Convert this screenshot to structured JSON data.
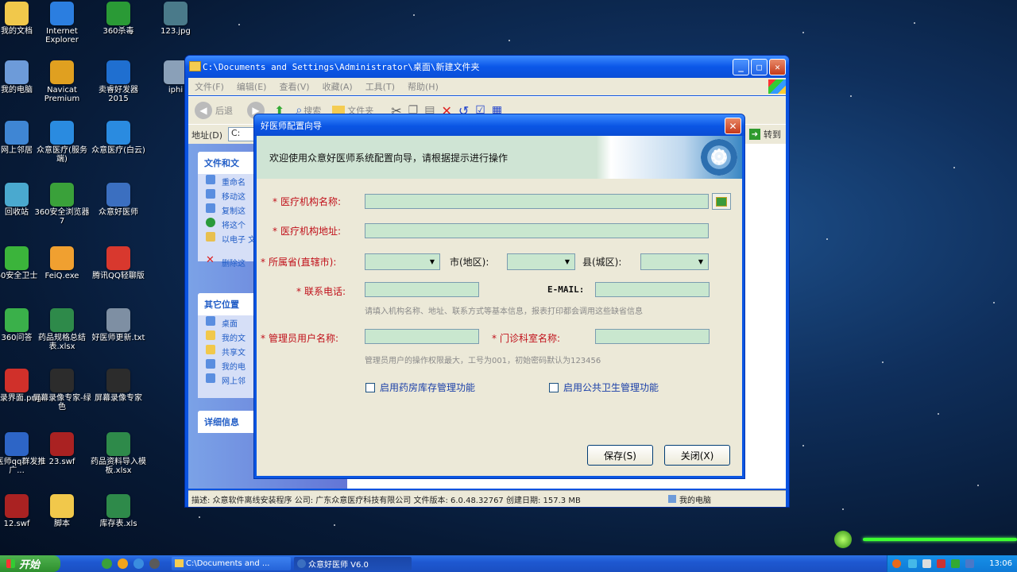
{
  "desktop": {
    "icons": [
      {
        "label": "我的文档",
        "icon": "folder-icon",
        "color": "#f1c84b"
      },
      {
        "label": "Internet Explorer",
        "icon": "ie-icon",
        "color": "#2b7ee0"
      },
      {
        "label": "360杀毒",
        "icon": "shield-icon",
        "color": "#2a9a36"
      },
      {
        "label": "123.jpg",
        "icon": "image-icon",
        "color": "#4a7a8a"
      },
      {
        "label": "我的电脑",
        "icon": "computer-icon",
        "color": "#6d9bd9"
      },
      {
        "label": "Navicat Premium",
        "icon": "navicat-icon",
        "color": "#e0a020"
      },
      {
        "label": "卖睿好发器 2015",
        "icon": "h-icon",
        "color": "#1f6fd0"
      },
      {
        "label": "iphi",
        "icon": "file-icon",
        "color": "#8aa0b8"
      },
      {
        "label": "网上邻居",
        "icon": "network-icon",
        "color": "#3f86d4"
      },
      {
        "label": "众意医疗(服务端)",
        "icon": "medical-icon",
        "color": "#2a8be0"
      },
      {
        "label": "众意医疗(白云)",
        "icon": "medical-icon",
        "color": "#2a8be0"
      },
      {
        "label": "回收站",
        "icon": "recycle-bin-icon",
        "color": "#4aa9cf"
      },
      {
        "label": "360安全浏览器7",
        "icon": "browser-icon",
        "color": "#3aa13a"
      },
      {
        "label": "众意好医师",
        "icon": "penguin-icon",
        "color": "#3b6fc0"
      },
      {
        "label": "60安全卫士",
        "icon": "guard-icon",
        "color": "#3bb43b"
      },
      {
        "label": "FeiQ.exe",
        "icon": "feiq-icon",
        "color": "#f0a030"
      },
      {
        "label": "腾讯QQ轻聊版",
        "icon": "qq-icon",
        "color": "#d8382e"
      },
      {
        "label": "360问答",
        "icon": "qa-icon",
        "color": "#3ab04a"
      },
      {
        "label": "药品规格总结表.xlsx",
        "icon": "excel-icon",
        "color": "#2e8a4a"
      },
      {
        "label": "好医师更新.txt",
        "icon": "text-icon",
        "color": "#7e8fa3"
      },
      {
        "label": "登录界面.png",
        "icon": "png-icon",
        "color": "#d0302a"
      },
      {
        "label": "屏幕录像专家-绿色",
        "icon": "recorder-icon",
        "color": "#2c2c2c"
      },
      {
        "label": "屏幕录像专家",
        "icon": "recorder-icon",
        "color": "#2c2c2c"
      },
      {
        "label": "好医师qq群发推广...",
        "icon": "doc-icon",
        "color": "#2d65c6"
      },
      {
        "label": "23.swf",
        "icon": "swf-icon",
        "color": "#aa2222"
      },
      {
        "label": "药品资料导入模板.xlsx",
        "icon": "excel-icon",
        "color": "#2e8a4a"
      },
      {
        "label": "12.swf",
        "icon": "swf-icon",
        "color": "#aa2222"
      },
      {
        "label": "脚本",
        "icon": "folder-icon",
        "color": "#f1c84b"
      },
      {
        "label": "库存表.xls",
        "icon": "excel-icon",
        "color": "#2e8a4a"
      }
    ]
  },
  "explorer": {
    "title": "C:\\Documents and Settings\\Administrator\\桌面\\新建文件夹",
    "menu": [
      "文件(F)",
      "编辑(E)",
      "查看(V)",
      "收藏(A)",
      "工具(T)",
      "帮助(H)"
    ],
    "toolbar": {
      "back": "后退",
      "search": "搜索",
      "folders": "文件夹"
    },
    "address_label": "地址(D)",
    "address_value": "C:",
    "go": "转到",
    "tasks_header": "文件和文",
    "tasks": [
      "重命名",
      "移动这",
      "复制这",
      "将这个",
      "以电子 文件",
      "删除这"
    ],
    "other_header": "其它位置",
    "other": [
      "桌面",
      "我的文",
      "共享文",
      "我的电",
      "网上邻"
    ],
    "details_header": "详细信息",
    "status": "描述: 众意软件离线安装程序  公司: 广东众意医疗科技有限公司  文件版本: 6.0.48.32767  创建日期: 157.3 MB",
    "status_right": "我的电脑"
  },
  "dialog": {
    "title": "好医师配置向导",
    "banner_text": "欢迎使用众意好医师系统配置向导，请根据提示进行操作",
    "required_mark": "*",
    "labels": {
      "org_name": "医疗机构名称:",
      "org_addr": "医疗机构地址:",
      "province": "所属省(直辖市):",
      "city": "市(地区):",
      "county": "县(城区):",
      "phone": "联系电话:",
      "email": "E-MAIL:",
      "admin": "管理员用户名称:",
      "dept": "门诊科室名称:"
    },
    "hint1": "请填入机构名称、地址、联系方式等基本信息，报表打印都会调用这些缺省信息",
    "hint2": "管理员用户的操作权限最大，工号为001，初始密码默认为123456",
    "check_pharmacy": "启用药房库存管理功能",
    "check_public_health": "启用公共卫生管理功能",
    "save": "保存(S)",
    "close": "关闭(X)"
  },
  "taskbar": {
    "start": "开始",
    "tasks": [
      "C:\\Documents and ...",
      "众意好医师 V6.0"
    ],
    "clock": "13:06"
  }
}
